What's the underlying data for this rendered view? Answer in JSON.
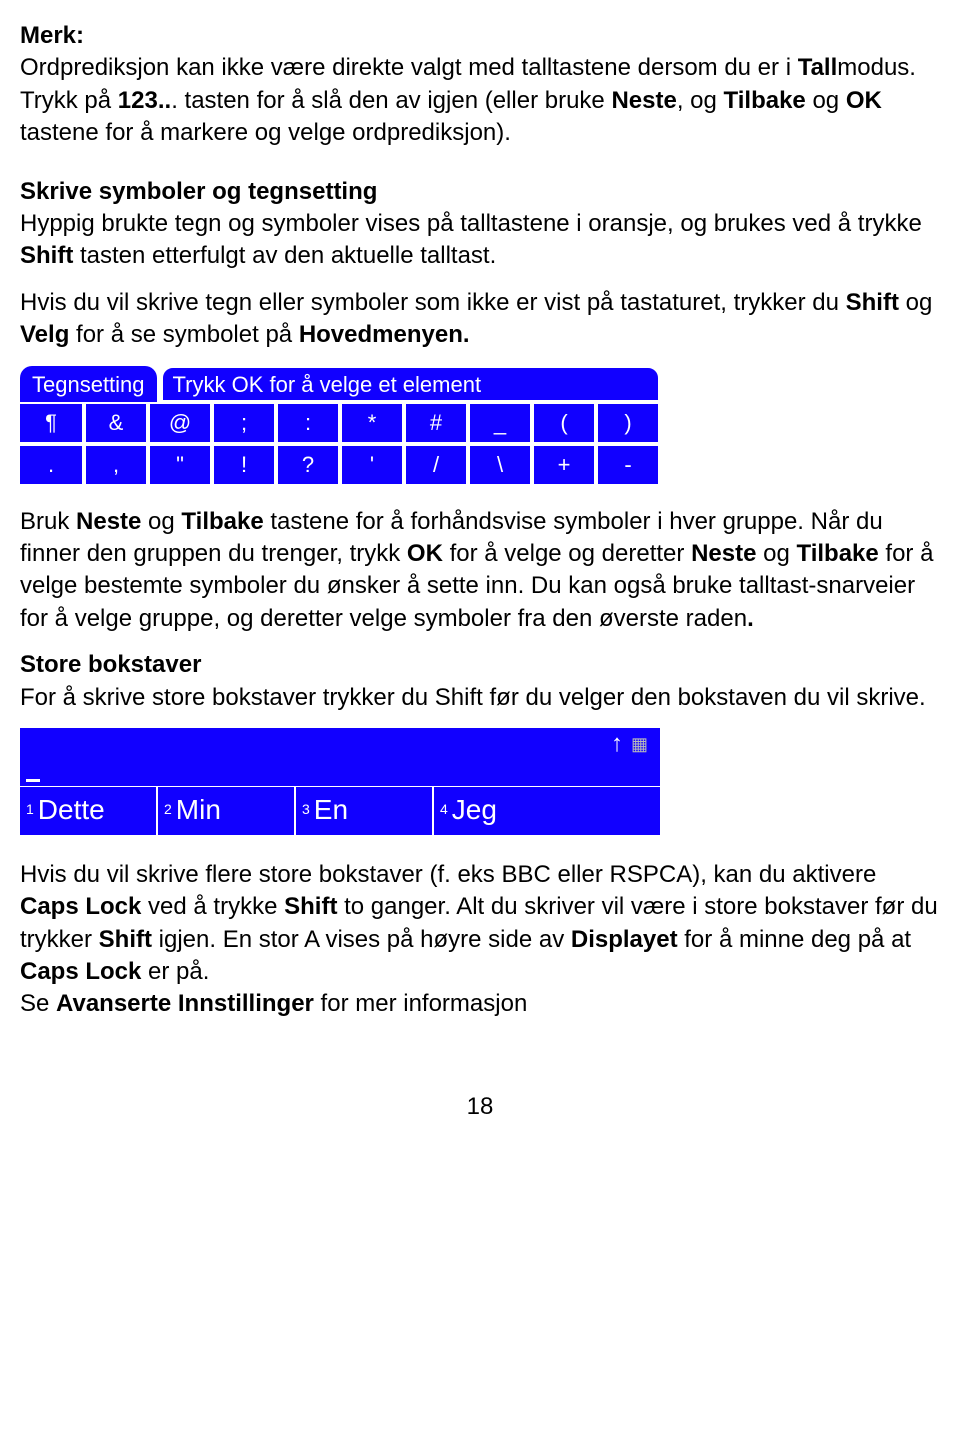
{
  "para1": {
    "l1": "Merk:",
    "l2a": "Ordprediksjon kan ikke være direkte valgt med talltastene dersom du er i ",
    "l2b": "Tall",
    "l2c": "modus. Trykk på ",
    "l2d": "123..",
    "l2e": ". tasten for å slå den av igjen (eller bruke ",
    "l2f": "Neste",
    "l2g": ", og ",
    "l2h": "Tilbake",
    "l2i": " og ",
    "l2j": "OK ",
    "l2k": "tastene for å markere og velge ordprediksjon)."
  },
  "para2": {
    "h": "Skrive symboler og tegnsetting",
    "p1a": " Hyppig brukte tegn og symboler vises på talltastene i oransje, og brukes ved å trykke ",
    "p1b": "Shift ",
    "p1c": "tasten etterfulgt av den aktuelle talltast.",
    "p2a": "Hvis du vil skrive tegn eller symboler som ikke er vist på tastaturet, trykker du ",
    "p2b": "Shift",
    "p2c": " og ",
    "p2d": "Velg",
    "p2e": " for å se symbolet på ",
    "p2f": "Hovedmenyen."
  },
  "img1": {
    "tab1": "Tegnsetting",
    "tab2": "Trykk OK for å velge et element",
    "row1": [
      "¶",
      "&",
      "@",
      ";",
      ":",
      "*",
      "#",
      "_",
      "(",
      ")"
    ],
    "row2": [
      ".",
      ",",
      "\"",
      "!",
      "?",
      "'",
      "/",
      "\\",
      "+",
      "-"
    ]
  },
  "para3": {
    "s1a": "Bruk ",
    "s1b": "Neste",
    "s1c": " og ",
    "s1d": "Tilbake",
    "s1e": " tastene for å forhåndsvise symboler i hver gruppe. Når du finner den gruppen du trenger, trykk ",
    "s1f": "OK",
    "s1g": " for å velge og deretter ",
    "s1h": "Neste",
    "s1i": " og ",
    "s1j": "Tilbake",
    "s1k": " for å velge bestemte symboler du ønsker å sette inn. Du kan også bruke talltast-snarveier for å velge gruppe, og deretter velge symboler fra den øverste raden",
    "s1l": "."
  },
  "para4": {
    "h": "Store bokstaver",
    "t": "For å skrive store bokstaver trykker du Shift før du velger den bokstaven du vil skrive."
  },
  "img2": {
    "w1n": "1",
    "w1": "Dette",
    "w2n": "2",
    "w2": "Min",
    "w3n": "3",
    "w3": "En",
    "w4n": "4",
    "w4": "Jeg"
  },
  "para5": {
    "s1": "Hvis du vil skrive flere store bokstaver (f. eks BBC eller RSPCA), kan du aktivere ",
    "s2": "Caps Lock",
    "s3": " ved å trykke ",
    "s4": "Shift",
    "s5": " to ganger. Alt du skriver vil være i store bokstaver før du trykker ",
    "s6": "Shift",
    "s7": " igjen. En stor A vises på høyre side av ",
    "s8": "Displayet",
    "s9": " for å minne deg på at ",
    "s10": "Caps Lock",
    "s11": " er på.",
    "line2a": "Se ",
    "line2b": "Avanserte",
    "line2c": " ",
    "line2d": "Innstillinger",
    "line2e": " for mer informasjon"
  },
  "page": "18"
}
